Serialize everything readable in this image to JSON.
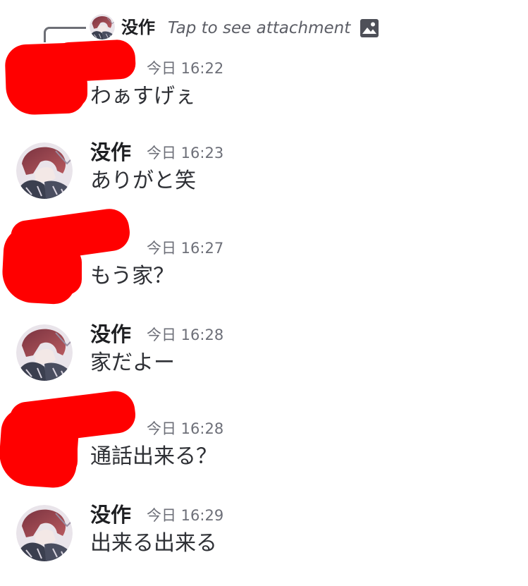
{
  "reply": {
    "author": "没作",
    "text": "Tap to see attachment",
    "icon": "image-icon"
  },
  "messages": [
    {
      "author": "",
      "time": "今日 16:22",
      "text": "わぁすげぇ",
      "redacted": true
    },
    {
      "author": "没作",
      "time": "今日 16:23",
      "text": "ありがと笑",
      "redacted": false
    },
    {
      "author": "",
      "time": "今日 16:27",
      "text": "もう家？",
      "redacted": true
    },
    {
      "author": "没作",
      "time": "今日 16:28",
      "text": "家だよー",
      "redacted": false
    },
    {
      "author": "",
      "time": "今日 16:28",
      "text": "通話出来る？",
      "redacted": true
    },
    {
      "author": "没作",
      "time": "今日 16:29",
      "text": "出来る出来る",
      "redacted": false
    }
  ],
  "colors": {
    "redaction": "#ff0000",
    "name": "#1e1f22",
    "text": "#2e3035",
    "muted": "#6d6f78"
  }
}
